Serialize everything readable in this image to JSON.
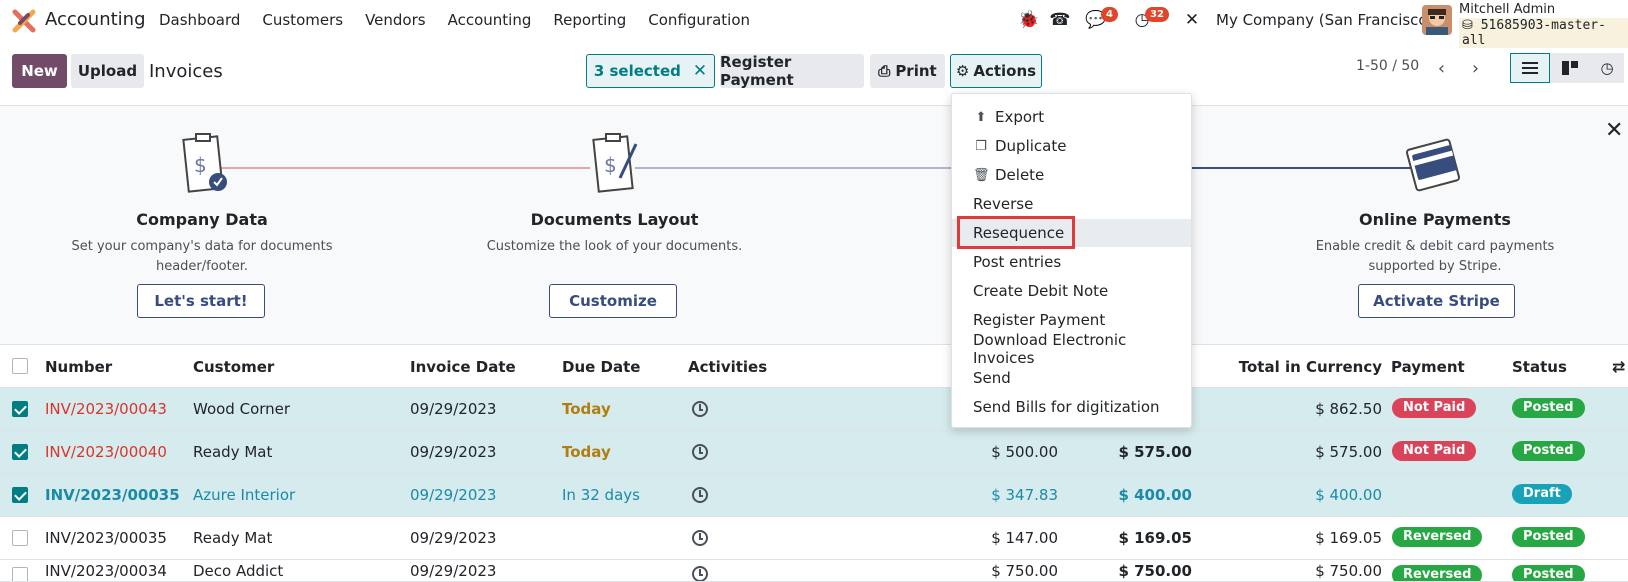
{
  "navbar": {
    "app_name": "Accounting",
    "menu": [
      "Dashboard",
      "Customers",
      "Vendors",
      "Accounting",
      "Reporting",
      "Configuration"
    ],
    "messages_count": "4",
    "activities_count": "32",
    "company": "My Company (San Francisco)",
    "user_name": "Mitchell Admin",
    "db_name": "51685903-master-all"
  },
  "control": {
    "new_label": "New",
    "upload_label": "Upload",
    "title": "Invoices",
    "selected_label": "3 selected",
    "register_payment_label": "Register Payment",
    "print_label": "Print",
    "actions_label": "Actions",
    "pager": "1-50 / 50"
  },
  "onboarding": {
    "steps": [
      {
        "title": "Company Data",
        "desc1": "Set your company's data for documents",
        "desc2": "header/footer.",
        "button": "Let's start!"
      },
      {
        "title": "Documents Layout",
        "desc1": "Customize the look of your documents.",
        "desc2": "",
        "button": "Customize"
      },
      {
        "title": "Online Payments",
        "desc1": "Enable credit & debit card payments",
        "desc2": "supported by Stripe.",
        "button": "Activate Stripe"
      }
    ]
  },
  "actions_menu": {
    "items": [
      "Export",
      "Duplicate",
      "Delete",
      "Reverse",
      "Resequence",
      "Post entries",
      "Create Debit Note",
      "Register Payment",
      "Download Electronic Invoices",
      "Send",
      "Send Bills for digitization"
    ],
    "icons": [
      "upload-icon",
      "duplicate-icon",
      "trash-icon"
    ]
  },
  "table": {
    "headers": {
      "number": "Number",
      "customer": "Customer",
      "invoice_date": "Invoice Date",
      "due_date": "Due Date",
      "activities": "Activities",
      "total_currency": "Total in Currency",
      "payment": "Payment",
      "status": "Status"
    },
    "rows": [
      {
        "number": "INV/2023/00043",
        "customer": "Wood Corner",
        "invoice_date": "09/29/2023",
        "due_date": "Today",
        "untaxed": "",
        "total": "",
        "total_currency": "$ 862.50",
        "payment": "Not Paid",
        "status": "Posted"
      },
      {
        "number": "INV/2023/00040",
        "customer": "Ready Mat",
        "invoice_date": "09/29/2023",
        "due_date": "Today",
        "untaxed": "$ 500.00",
        "total": "$ 575.00",
        "total_currency": "$ 575.00",
        "payment": "Not Paid",
        "status": "Posted"
      },
      {
        "number": "INV/2023/00035",
        "customer": "Azure Interior",
        "invoice_date": "09/29/2023",
        "due_date": "In 32 days",
        "untaxed": "$ 347.83",
        "total": "$ 400.00",
        "total_currency": "$ 400.00",
        "payment": "",
        "status": "Draft"
      },
      {
        "number": "INV/2023/00035",
        "customer": "Ready Mat",
        "invoice_date": "09/29/2023",
        "due_date": "",
        "untaxed": "$ 147.00",
        "total": "$ 169.05",
        "total_currency": "$ 169.05",
        "payment": "Reversed",
        "status": "Posted"
      },
      {
        "number": "INV/2023/00034",
        "customer": "Deco Addict",
        "invoice_date": "09/29/2023",
        "due_date": "",
        "untaxed": "$ 750.00",
        "total": "$ 750.00",
        "total_currency": "$ 750.00",
        "payment": "Reversed",
        "status": "Posted"
      }
    ]
  },
  "colors": {
    "brand": "#714b67",
    "teal": "#017e84",
    "danger": "#e4442b",
    "success": "#28a745",
    "info": "#17a2b8"
  }
}
